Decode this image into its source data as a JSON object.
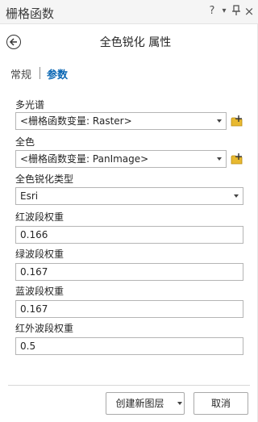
{
  "window": {
    "title": "栅格函数",
    "help_glyph": "?",
    "menu_glyph": "▾",
    "pin_glyph": "ᵠ",
    "close_glyph": "×"
  },
  "header": {
    "title": "全色锐化 属性",
    "back_icon": "back-arrow-icon"
  },
  "tabs": [
    {
      "label": "常规",
      "active": false
    },
    {
      "label": "参数",
      "active": true
    }
  ],
  "fields": {
    "multispectral": {
      "label": "多光谱",
      "value": "<栅格函数变量: Raster>"
    },
    "panchromatic": {
      "label": "全色",
      "value": "<栅格函数变量: PanImage>"
    },
    "pansharpen_type": {
      "label": "全色锐化类型",
      "value": "Esri"
    },
    "red_weight": {
      "label": "红波段权重",
      "value": "0.166"
    },
    "green_weight": {
      "label": "绿波段权重",
      "value": "0.167"
    },
    "blue_weight": {
      "label": "蓝波段权重",
      "value": "0.167"
    },
    "infrared_weight": {
      "label": "红外波段权重",
      "value": "0.5"
    }
  },
  "buttons": {
    "create_label": "创建新图层",
    "cancel_label": "取消"
  },
  "colors": {
    "accent": "#0a67b4",
    "folder": "#e8b930"
  }
}
